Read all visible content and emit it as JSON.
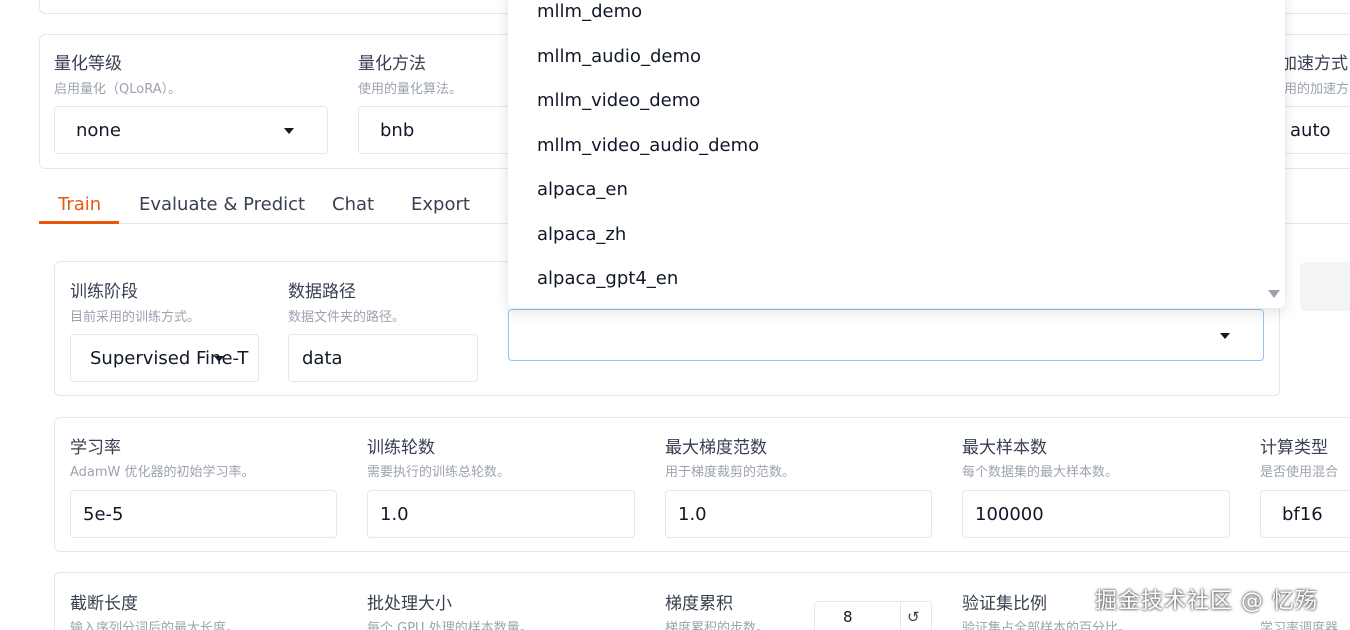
{
  "quant": {
    "level_label": "量化等级",
    "level_info": "启用量化（QLoRA）。",
    "level_value": "none",
    "method_label": "量化方法",
    "method_info": "使用的量化算法。",
    "method_value": "bnb",
    "accel_label": "加速方式",
    "accel_info": "用的加速方",
    "accel_value": "auto"
  },
  "tabs": [
    {
      "label": "Train"
    },
    {
      "label": "Evaluate & Predict"
    },
    {
      "label": "Chat"
    },
    {
      "label": "Export"
    }
  ],
  "stage": {
    "label": "训练阶段",
    "info": "目前采用的训练方式。",
    "value": "Supervised Fine-T"
  },
  "dataset_dir": {
    "label": "数据路径",
    "info": "数据文件夹的路径。",
    "value": "data"
  },
  "dataset": {
    "value": ""
  },
  "dropdown": {
    "options": [
      "mllm_demo",
      "mllm_audio_demo",
      "mllm_video_demo",
      "mllm_video_audio_demo",
      "alpaca_en",
      "alpaca_zh",
      "alpaca_gpt4_en"
    ]
  },
  "hyper": {
    "lr_label": "学习率",
    "lr_info": "AdamW 优化器的初始学习率。",
    "lr_value": "5e-5",
    "epochs_label": "训练轮数",
    "epochs_info": "需要执行的训练总轮数。",
    "epochs_value": "1.0",
    "grad_norm_label": "最大梯度范数",
    "grad_norm_info": "用于梯度裁剪的范数。",
    "grad_norm_value": "1.0",
    "samples_label": "最大样本数",
    "samples_info": "每个数据集的最大样本数。",
    "samples_value": "100000",
    "compute_label": "计算类型",
    "compute_info": "是否使用混合",
    "compute_value": "bf16"
  },
  "row4": {
    "cutoff_label": "截断长度",
    "cutoff_info": "输入序列分词后的最大长度。",
    "batch_label": "批处理大小",
    "batch_info": "每个 GPU 处理的样本数量。",
    "grad_accum_label": "梯度累积",
    "grad_accum_info": "梯度累积的步数。",
    "grad_accum_value": "8",
    "reset_icon": "↺",
    "val_label": "验证集比例",
    "val_info": "验证集占全部样本的百分比。",
    "sched_info": "学习率调度器"
  },
  "watermark": "掘金技术社区 @ 忆殇"
}
